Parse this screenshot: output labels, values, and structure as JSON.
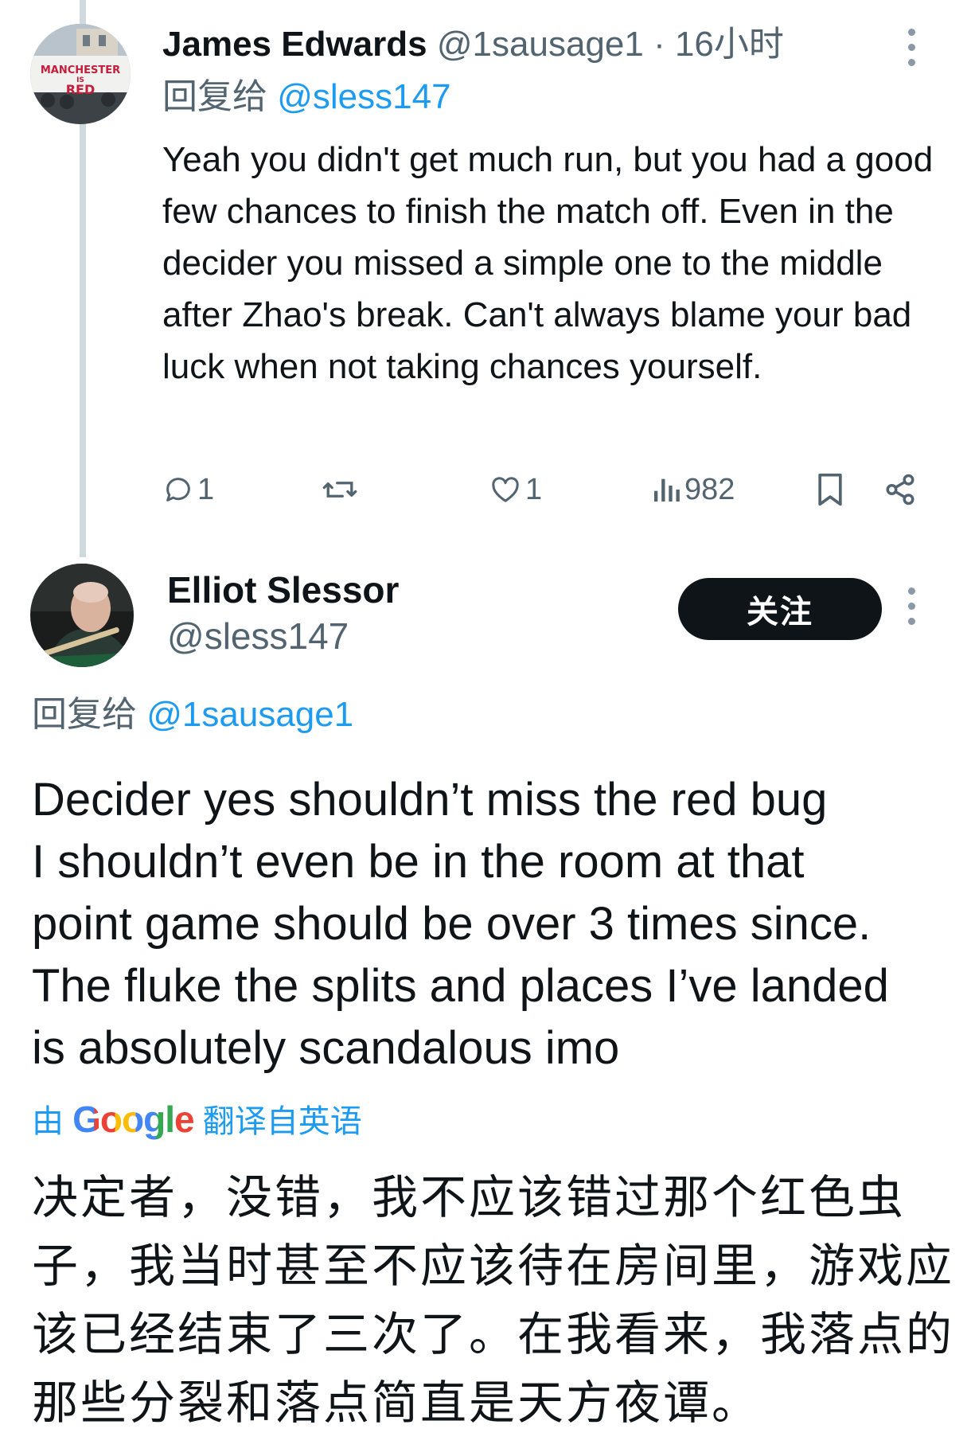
{
  "tweet1": {
    "author_name": "James Edwards",
    "author_handle": "@1sausage1",
    "time": "16小时",
    "avatar_banner_text": "MANCHESTER IS RED",
    "reply_prefix": "回复给",
    "reply_handle": "@sless147",
    "body": "Yeah you didn't get much run, but you had a good few chances to finish the match off. Even in the decider you missed a simple one to the middle after Zhao's break. Can't always blame your bad luck when not taking chances yourself.",
    "actions": {
      "reply_count": "1",
      "repost_count": "",
      "like_count": "1",
      "view_count": "982"
    },
    "icons": [
      "reply-icon",
      "repost-icon",
      "like-icon",
      "views-icon",
      "bookmark-icon",
      "share-icon",
      "more-icon"
    ]
  },
  "tweet2": {
    "author_name": "Elliot Slessor",
    "author_handle": "@sless147",
    "follow_label": "关注",
    "reply_prefix": "回复给",
    "reply_handle": "@1sausage1",
    "body_lines": [
      "Decider yes shouldn’t miss the red bug",
      "I shouldn’t even be in the room at that",
      "point game should be over 3 times since.",
      "The fluke the splits and places I’ve landed",
      "is absolutely scandalous imo"
    ],
    "translate_prefix": "由",
    "translate_brand": "Google",
    "translate_suffix": "翻译自英语",
    "translated_lines": [
      "决定者，没错，我不应该错过那个红色虫",
      "子，我当时甚至不应该待在房间里，游戏应",
      "该已经结束了三次了。在我看来，我落点的",
      "那些分裂和落点简直是天方夜谭。"
    ]
  },
  "colors": {
    "accent": "#1d9bf0",
    "text": "#0f1419",
    "secondary": "#536471",
    "thread_line": "#cfd9de",
    "follow_bg": "#0f1419"
  }
}
